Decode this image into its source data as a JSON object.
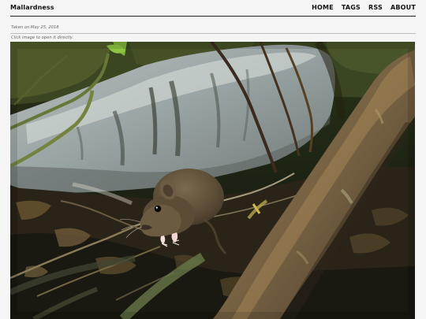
{
  "site": {
    "title": "Mallardness"
  },
  "nav": {
    "items": [
      {
        "label": "HOME"
      },
      {
        "label": "TAGS"
      },
      {
        "label": "RSS"
      },
      {
        "label": "ABOUT"
      }
    ]
  },
  "post": {
    "date_text": "Taken on May 25, 2018",
    "hint_text": "Click image to open it directly."
  },
  "colors": {
    "background": "#f5f5f5",
    "text": "#111111",
    "muted": "#666666",
    "rule_dark": "#222222",
    "rule_light": "#bdbdbd"
  }
}
